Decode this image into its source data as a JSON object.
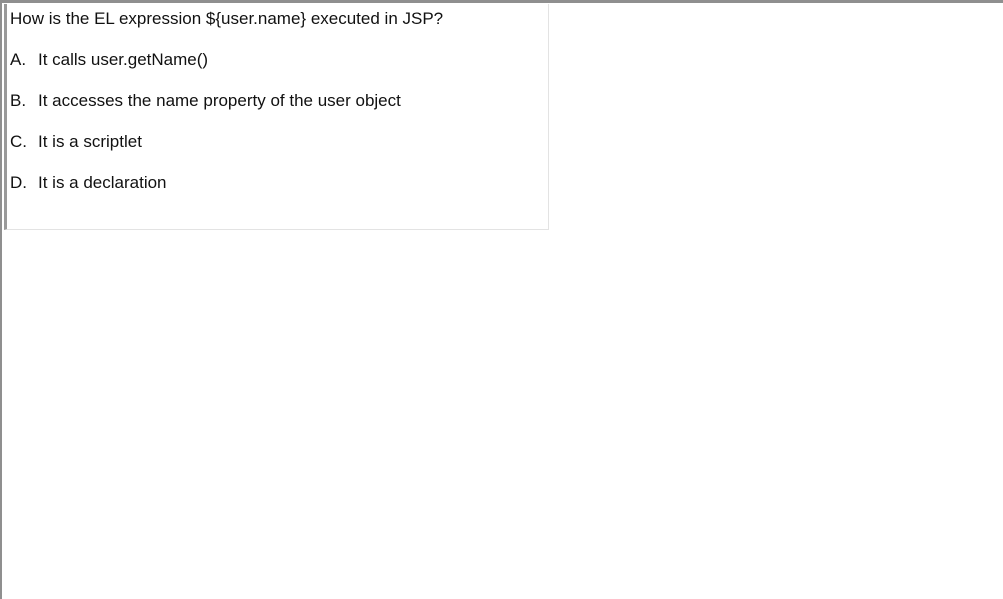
{
  "quiz": {
    "question": "How is the EL expression ${user.name} executed in JSP?",
    "options": [
      {
        "letter": "A.",
        "text": "It calls user.getName()"
      },
      {
        "letter": "B.",
        "text": "It accesses the name property of the user object"
      },
      {
        "letter": "C.",
        "text": "It is a scriptlet"
      },
      {
        "letter": "D.",
        "text": "It is a declaration"
      }
    ]
  }
}
